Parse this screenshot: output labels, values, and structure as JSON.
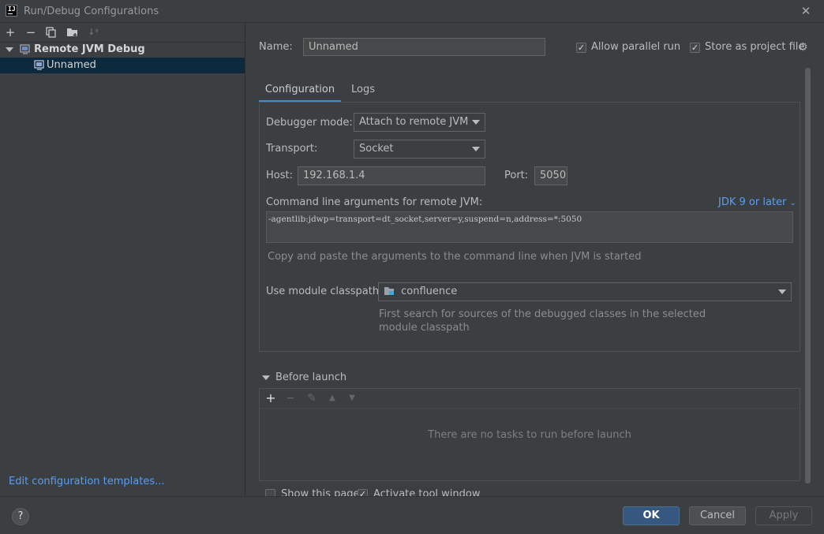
{
  "window": {
    "title": "Run/Debug Configurations",
    "app_icon_text": "IJ"
  },
  "left_panel": {
    "toolbar_icons": [
      "add-icon",
      "remove-icon",
      "copy-icon",
      "folder-icon",
      "sort-icon"
    ],
    "tree_group": "Remote JVM Debug",
    "tree_item": "Unnamed",
    "edit_templates": "Edit configuration templates..."
  },
  "form": {
    "name_label": "Name:",
    "name_value": "Unnamed",
    "allow_parallel_label": "Allow parallel run",
    "allow_parallel_checked": true,
    "store_project_label": "Store as project file",
    "store_project_checked": true
  },
  "tabs": [
    {
      "label": "Configuration",
      "active": true
    },
    {
      "label": "Logs",
      "active": false
    }
  ],
  "config": {
    "debugger_mode_label": "Debugger mode:",
    "debugger_mode_value": "Attach to remote JVM",
    "transport_label": "Transport:",
    "transport_value": "Socket",
    "host_label": "Host:",
    "host_value": "192.168.1.4",
    "port_label": "Port:",
    "port_value": "5050",
    "cmd_label": "Command line arguments for remote JVM:",
    "jdk_link": "JDK 9 or later",
    "cmd_value": "-agentlib:jdwp=transport=dt_socket,server=y,suspend=n,address=*:5050",
    "cmd_hint": "Copy and paste the arguments to the command line when JVM is started",
    "module_label": "Use module classpath:",
    "module_value": "confluence",
    "module_hint": "First search for sources of the debugged classes in the selected module classpath"
  },
  "before_launch": {
    "label": "Before launch",
    "empty_text": "There are no tasks to run before launch"
  },
  "footer_options": {
    "show_page_label": "Show this page",
    "show_page_checked": false,
    "activate_tool_label": "Activate tool window",
    "activate_tool_checked": true
  },
  "buttons": {
    "help": "?",
    "ok": "OK",
    "cancel": "Cancel",
    "apply": "Apply"
  },
  "colors": {
    "accent": "#4a88c7",
    "link": "#589df6",
    "ok_button": "#365880",
    "selection": "#0d293e"
  }
}
